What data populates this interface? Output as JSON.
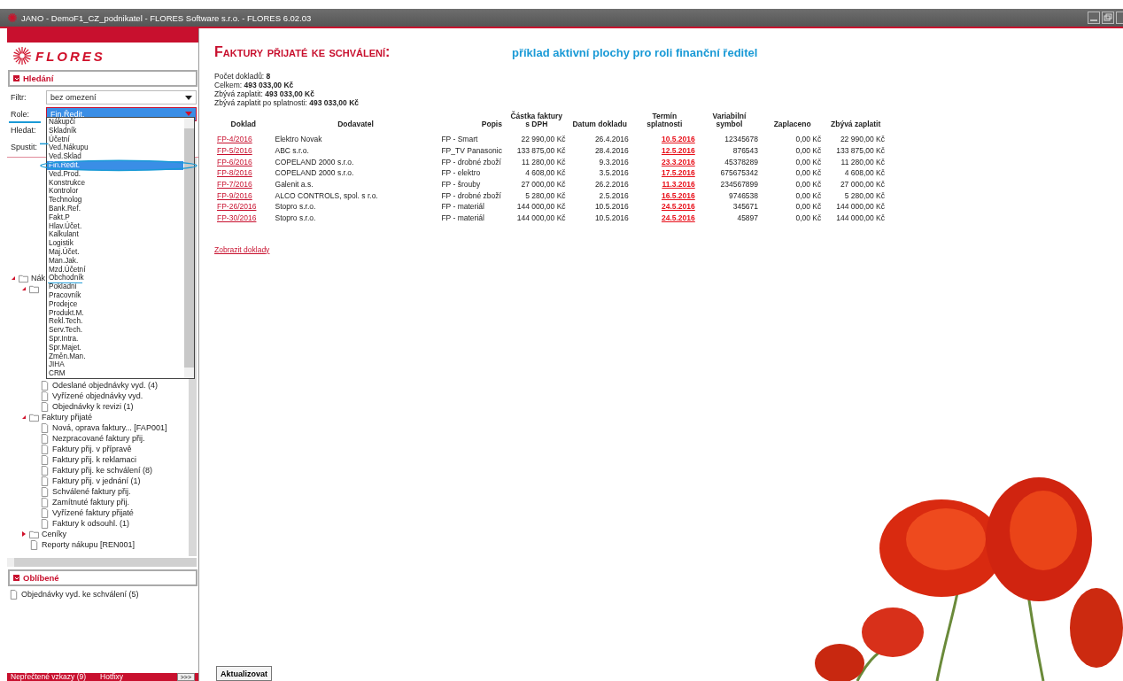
{
  "window": {
    "title": "JANO - DemoF1_CZ_podnikatel - FLORES Software  s.r.o. - FLORES 6.02.03"
  },
  "sidebar": {
    "logo": "FLORES",
    "search_panel": {
      "title": "Hledání",
      "expanded": true,
      "fields": [
        {
          "label": "Filtr:",
          "value": "bez omezení",
          "kind": "select",
          "focused": false
        },
        {
          "label": "Role:",
          "value": "Fin.Ředit.",
          "kind": "select",
          "focused": true
        },
        {
          "label": "Hledat:",
          "kind": "text"
        },
        {
          "label": "Spustit:",
          "kind": "text"
        }
      ],
      "role_options": [
        {
          "label": "Nákupčí",
          "selected": false
        },
        {
          "label": "Skladník",
          "selected": false
        },
        {
          "label": "Účetní",
          "selected": false
        },
        {
          "label": "Ved.Nákupu",
          "selected": false
        },
        {
          "label": "Ved.Sklad",
          "selected": false
        },
        {
          "label": "Fin.Ředit.",
          "selected": true
        },
        {
          "label": "Ved.Prod.",
          "selected": false
        },
        {
          "label": "Konstrukce",
          "selected": false
        },
        {
          "label": "Kontrolor",
          "selected": false
        },
        {
          "label": "Technolog",
          "selected": false
        },
        {
          "label": "Bank.Ref.",
          "selected": false
        },
        {
          "label": "Fakt.P",
          "selected": false
        },
        {
          "label": "Hlav.Účet.",
          "selected": false
        },
        {
          "label": "Kalkulant",
          "selected": false
        },
        {
          "label": "Logistik",
          "selected": false
        },
        {
          "label": "Maj.Účet.",
          "selected": false
        },
        {
          "label": "Man.Jak.",
          "selected": false
        },
        {
          "label": "Mzd.Účetní",
          "selected": false
        },
        {
          "label": "Obchodník",
          "selected": false
        },
        {
          "label": "Pokladní",
          "selected": false
        },
        {
          "label": "Pracovník",
          "selected": false
        },
        {
          "label": "Prodejce",
          "selected": false
        },
        {
          "label": "Produkt.M.",
          "selected": false
        },
        {
          "label": "Rekl.Tech.",
          "selected": false
        },
        {
          "label": "Serv.Tech.",
          "selected": false
        },
        {
          "label": "Spr.Intra.",
          "selected": false
        },
        {
          "label": "Spr.Majet.",
          "selected": false
        },
        {
          "label": "Změn.Man.",
          "selected": false
        },
        {
          "label": "JIHA",
          "selected": false
        },
        {
          "label": "CRM",
          "selected": false
        }
      ]
    },
    "tree": [
      {
        "label": "Nák",
        "kind": "folder",
        "expanded": true,
        "children": [
          {
            "kind": "folder",
            "expanded": true,
            "children": [
              {
                "label": "Odeslané objednávky vyd. (4)",
                "kind": "document"
              },
              {
                "label": "Vyřízené objednávky vyd.",
                "kind": "document"
              },
              {
                "label": "Objednávky k revizi (1)",
                "kind": "document"
              }
            ]
          },
          {
            "label": "Faktury přijaté",
            "kind": "folder",
            "expanded": true,
            "children": [
              {
                "label": "Nová, oprava faktury... [FAP001]",
                "kind": "document"
              },
              {
                "label": "Nezpracované faktury přij.",
                "kind": "document"
              },
              {
                "label": "Faktury přij. v přípravě",
                "kind": "document"
              },
              {
                "label": "Faktury přij. k reklamaci",
                "kind": "document"
              },
              {
                "label": "Faktury přij. ke schválení (8)",
                "kind": "document"
              },
              {
                "label": "Faktury přij. v jednání (1)",
                "kind": "document"
              },
              {
                "label": "Schválené faktury přij.",
                "kind": "document"
              },
              {
                "label": "Zamítnuté faktury přij.",
                "kind": "document"
              },
              {
                "label": "Vyřízené faktury přijaté",
                "kind": "document"
              },
              {
                "label": "Faktury k odsouhl. (1)",
                "kind": "document"
              }
            ]
          },
          {
            "label": "Ceníky",
            "kind": "folder",
            "expanded": false
          },
          {
            "label": "Reporty nákupu [REN001]",
            "kind": "document"
          }
        ]
      }
    ],
    "favorites": {
      "title": "Oblíbené",
      "expanded": true,
      "items": [
        "Objednávky vyd. ke schválení (5)"
      ]
    },
    "footer": {
      "messages": "Nepřečtené vzkazy (9)",
      "hotfixes": "Hotfixy",
      "more_button": ">>>"
    }
  },
  "main": {
    "title": "Faktury přijaté ke schválení:",
    "subtitle": "příklad aktivní plochy pro roli finanční ředitel",
    "summary": [
      {
        "label": "Počet dokladů:",
        "value": "8"
      },
      {
        "label": "Celkem:",
        "value": "493 033,00 Kč"
      },
      {
        "label": "Zbývá zaplatit:",
        "value": "493 033,00 Kč"
      },
      {
        "label": "Zbývá zaplatit po splatnosti:",
        "value": "493 033,00 Kč"
      }
    ],
    "table": {
      "columns": [
        "Doklad",
        "Dodavatel",
        "Popis",
        "Částka faktury s DPH",
        "Datum dokladu",
        "Termín splatnosti",
        "Variabilní symbol",
        "Zaplaceno",
        "Zbývá zaplatit"
      ],
      "rows": [
        {
          "doklad": "FP-4/2016",
          "dodavatel": "Elektro Novak",
          "popis": "FP - Smart",
          "castka": "22 990,00 Kč",
          "datum": "26.4.2016",
          "termin": "10.5.2016",
          "overdue": true,
          "vs": "12345678",
          "zaplaceno": "0,00 Kč",
          "zbyva": "22 990,00 Kč"
        },
        {
          "doklad": "FP-5/2016",
          "dodavatel": "ABC s.r.o.",
          "popis": "FP_TV Panasonic",
          "castka": "133 875,00 Kč",
          "datum": "28.4.2016",
          "termin": "12.5.2016",
          "overdue": true,
          "vs": "876543",
          "zaplaceno": "0,00 Kč",
          "zbyva": "133 875,00 Kč"
        },
        {
          "doklad": "FP-6/2016",
          "dodavatel": "COPELAND 2000 s.r.o.",
          "popis": "FP - drobné zboží",
          "castka": "11 280,00 Kč",
          "datum": "9.3.2016",
          "termin": "23.3.2016",
          "overdue": true,
          "vs": "45378289",
          "zaplaceno": "0,00 Kč",
          "zbyva": "11 280,00 Kč"
        },
        {
          "doklad": "FP-8/2016",
          "dodavatel": "COPELAND 2000 s.r.o.",
          "popis": "FP - elektro",
          "castka": "4 608,00 Kč",
          "datum": "3.5.2016",
          "termin": "17.5.2016",
          "overdue": true,
          "vs": "675675342",
          "zaplaceno": "0,00 Kč",
          "zbyva": "4 608,00 Kč"
        },
        {
          "doklad": "FP-7/2016",
          "dodavatel": "Galenit a.s.",
          "popis": "FP - šrouby",
          "castka": "27 000,00 Kč",
          "datum": "26.2.2016",
          "termin": "11.3.2016",
          "overdue": true,
          "vs": "234567899",
          "zaplaceno": "0,00 Kč",
          "zbyva": "27 000,00 Kč"
        },
        {
          "doklad": "FP-9/2016",
          "dodavatel": "ALCO CONTROLS, spol. s r.o.",
          "popis": "FP - drobné zboží",
          "castka": "5 280,00 Kč",
          "datum": "2.5.2016",
          "termin": "16.5.2016",
          "overdue": true,
          "vs": "9746538",
          "zaplaceno": "0,00 Kč",
          "zbyva": "5 280,00 Kč"
        },
        {
          "doklad": "FP-26/2016",
          "dodavatel": "Stopro s.r.o.",
          "popis": "FP - materiál",
          "castka": "144 000,00 Kč",
          "datum": "10.5.2016",
          "termin": "24.5.2016",
          "overdue": true,
          "vs": "345671",
          "zaplaceno": "0,00 Kč",
          "zbyva": "144 000,00 Kč"
        },
        {
          "doklad": "FP-30/2016",
          "dodavatel": "Stopro s.r.o.",
          "popis": "FP - materiál",
          "castka": "144 000,00 Kč",
          "datum": "10.5.2016",
          "termin": "24.5.2016",
          "overdue": true,
          "vs": "45897",
          "zaplaceno": "0,00 Kč",
          "zbyva": "144 000,00 Kč"
        }
      ]
    },
    "link": "Zobrazit doklady",
    "refresh_button": "Aktualizovat"
  }
}
